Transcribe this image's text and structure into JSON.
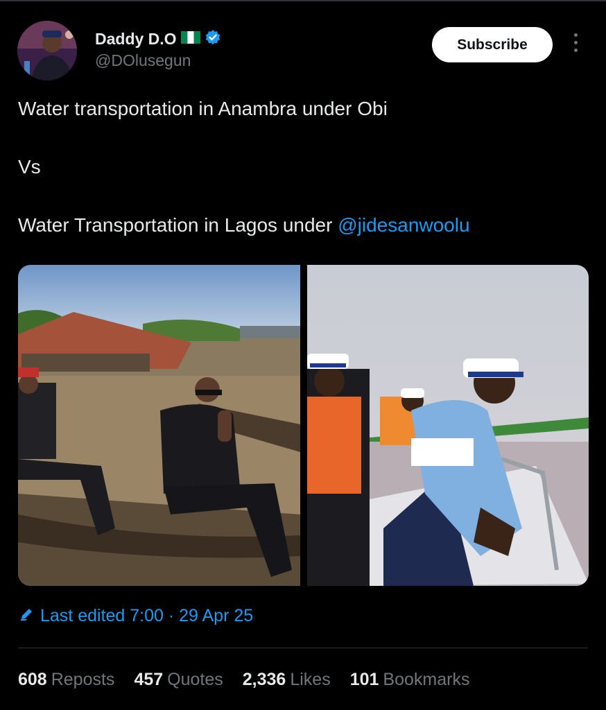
{
  "author": {
    "display_name": "Daddy D.O",
    "handle": "@DOlusegun",
    "flag_icon": "nigeria-flag-icon",
    "verified_icon": "verified-badge-icon"
  },
  "header": {
    "subscribe_label": "Subscribe",
    "more_icon": "more-options-icon"
  },
  "tweet": {
    "line1": "Water transportation in Anambra under Obi",
    "line2": "Vs",
    "line3_prefix": "Water Transportation in Lagos under ",
    "mention": "@jidesanwoolu"
  },
  "media": {
    "image1": "photo-men-in-canoe-flooded-river",
    "image2": "photo-officials-on-boat-in-life-jackets"
  },
  "edited": {
    "icon": "pencil-icon",
    "label": "Last edited 7:00 · 29 Apr 25"
  },
  "stats": [
    {
      "value": "608",
      "label": "Reposts"
    },
    {
      "value": "457",
      "label": "Quotes"
    },
    {
      "value": "2,336",
      "label": "Likes"
    },
    {
      "value": "101",
      "label": "Bookmarks"
    }
  ],
  "colors": {
    "accent": "#1d9bf0",
    "background": "#000000",
    "text": "#e7e9ea",
    "muted": "#71767b"
  }
}
